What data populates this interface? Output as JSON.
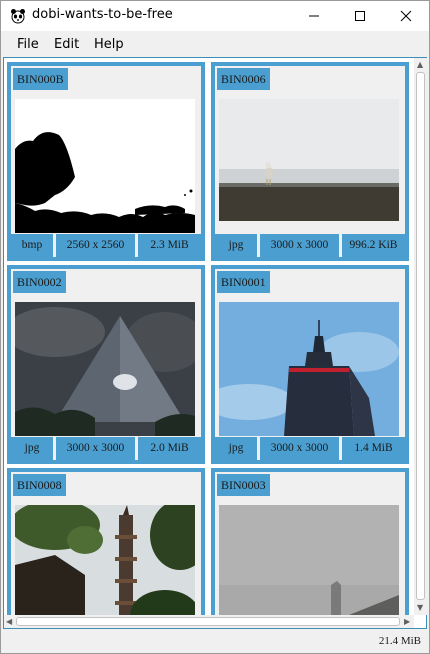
{
  "window": {
    "title": "dobi-wants-to-be-free",
    "minimize_icon": "minimize-icon",
    "maximize_icon": "maximize-icon",
    "close_icon": "close-icon"
  },
  "menu": [
    "File",
    "Edit",
    "Help"
  ],
  "cards": [
    {
      "id": "BIN000B",
      "type": "bmp",
      "dims": "2560 x 2560",
      "size": "2.3 MiB"
    },
    {
      "id": "BIN0006",
      "type": "jpg",
      "dims": "3000 x 3000",
      "size": "996.2 KiB"
    },
    {
      "id": "BIN0002",
      "type": "jpg",
      "dims": "3000 x 3000",
      "size": "2.0 MiB"
    },
    {
      "id": "BIN0001",
      "type": "jpg",
      "dims": "3000 x 3000",
      "size": "1.4 MiB"
    },
    {
      "id": "BIN0008"
    },
    {
      "id": "BIN0003"
    }
  ],
  "status": {
    "total_size": "21.4 MiB"
  },
  "colors": {
    "accent": "#4a9fd0",
    "frame": "#3b8fb6"
  }
}
